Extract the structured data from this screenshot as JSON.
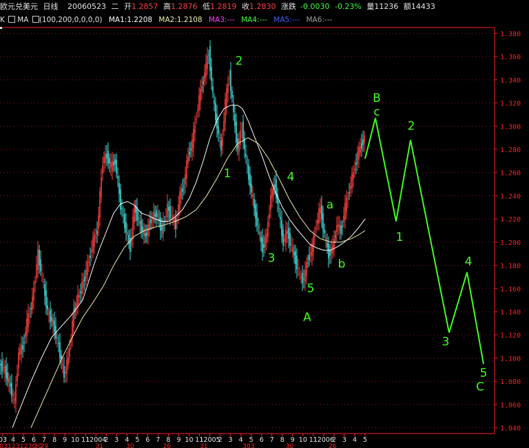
{
  "header": {
    "symbol": "欧元兑美元",
    "period": "日线",
    "date": "20060523",
    "weekday": "二",
    "open_label": "开",
    "open": "1.2857",
    "high_label": "高",
    "high": "1.2876",
    "low_label": "低",
    "low": "1.2819",
    "close_label": "收",
    "close": "1.2830",
    "change_label": "涨跌",
    "change": "-0.0030",
    "change_pct": "-0.23%",
    "volume_label": "量",
    "volume": "11236",
    "amount_label": "额",
    "amount": "14433"
  },
  "indicator": {
    "k_label": "K",
    "ma_label": "MA",
    "params": "(100,200,0,0,0,0)",
    "ma1": "MA1:1.2208",
    "ma2": "MA2:1.2108",
    "ma3": "MA3:---",
    "ma4": "MA4:---",
    "ma5": "MA5:---",
    "ma6": "MA6:---"
  },
  "colors": {
    "up": "#ff4040",
    "down": "#40e0e0",
    "ma1": "#ffffff",
    "ma2": "#f0f0b0",
    "ma3": "#ff40ff",
    "ma4": "#40ff40",
    "ma5": "#4060ff",
    "ma6": "#a0a0a0",
    "wave": "#40ff20",
    "axis": "#ff2020",
    "grid": "#a01818",
    "text": "#e6e6e6"
  },
  "chart_data": {
    "type": "line",
    "ylim": [
      1.035,
      1.385
    ],
    "yticks": [
      "1.380",
      "1.360",
      "1.340",
      "1.320",
      "1.300",
      "1.280",
      "1.260",
      "1.240",
      "1.220",
      "1.200",
      "1.180",
      "1.160",
      "1.140",
      "1.120",
      "1.100",
      "1.080",
      "1.060",
      "1.040"
    ],
    "month_ticks": [
      "03",
      "4",
      "5",
      "6",
      "7",
      "8",
      "9",
      "10",
      "11",
      "12004",
      "2",
      "3",
      "4",
      "5",
      "6",
      "7",
      "8",
      "9",
      "10",
      "11",
      "12005",
      "2",
      "3",
      "4",
      "5",
      "6",
      "7",
      "8",
      "9",
      "10",
      "11",
      "12006",
      "2",
      "3",
      "4",
      "5"
    ],
    "day_ticks": [
      "0",
      "31",
      "2",
      "31",
      "2",
      "30",
      "30",
      "29",
      "",
      "",
      "",
      "",
      "",
      "",
      "",
      "",
      "31",
      "",
      "",
      "",
      "",
      "30",
      "",
      "",
      "",
      "",
      "",
      "26",
      "",
      "",
      "",
      "",
      "",
      "31",
      "",
      "",
      "",
      "",
      "",
      "",
      "30",
      "3",
      "",
      "",
      "",
      "",
      "",
      "30",
      "",
      "",
      "",
      "",
      "",
      "",
      "26",
      "",
      "",
      "",
      "",
      "",
      "",
      "30",
      "3"
    ],
    "price_series": {
      "name": "EURUSD",
      "x": [
        0,
        8,
        16,
        22,
        28,
        34,
        40,
        48,
        56,
        62,
        70,
        78,
        86,
        94,
        100,
        108,
        116,
        124,
        130,
        136,
        142,
        150,
        156,
        162,
        168,
        176,
        184,
        190,
        196,
        204,
        212,
        220,
        228,
        236,
        244,
        250,
        256,
        262,
        268,
        274,
        280,
        286,
        292,
        298,
        304,
        310,
        316,
        322,
        328,
        334,
        340,
        346,
        352,
        358,
        364,
        370,
        376,
        382,
        388,
        394,
        400,
        406,
        412,
        418,
        424,
        430,
        436,
        442,
        448,
        454,
        460,
        466,
        472,
        478,
        484,
        490,
        496,
        502,
        508,
        514,
        520,
        526,
        530
      ],
      "y": [
        1.095,
        1.09,
        1.075,
        1.062,
        1.105,
        1.11,
        1.13,
        1.15,
        1.19,
        1.17,
        1.14,
        1.13,
        1.11,
        1.085,
        1.1,
        1.14,
        1.155,
        1.17,
        1.185,
        1.2,
        1.21,
        1.27,
        1.275,
        1.265,
        1.27,
        1.232,
        1.21,
        1.195,
        1.23,
        1.215,
        1.205,
        1.22,
        1.225,
        1.21,
        1.23,
        1.222,
        1.215,
        1.24,
        1.25,
        1.275,
        1.285,
        1.31,
        1.33,
        1.345,
        1.365,
        1.325,
        1.3,
        1.28,
        1.32,
        1.345,
        1.31,
        1.28,
        1.3,
        1.27,
        1.25,
        1.23,
        1.21,
        1.195,
        1.205,
        1.24,
        1.25,
        1.225,
        1.2,
        1.21,
        1.195,
        1.185,
        1.17,
        1.168,
        1.185,
        1.195,
        1.215,
        1.23,
        1.205,
        1.19,
        1.195,
        1.215,
        1.21,
        1.23,
        1.245,
        1.26,
        1.275,
        1.285,
        1.29
      ]
    },
    "ma1_series": {
      "name": "MA1",
      "x": [
        18,
        30,
        45,
        60,
        75,
        90,
        105,
        120,
        135,
        145,
        155,
        165,
        175,
        185,
        195,
        205,
        215,
        225,
        235,
        245,
        255,
        265,
        275,
        285,
        295,
        305,
        315,
        325,
        335,
        345,
        352,
        360,
        370,
        380,
        390,
        400,
        410,
        420,
        430,
        440,
        450,
        460,
        470,
        480,
        490,
        500,
        510,
        520,
        530
      ],
      "y": [
        1.04,
        1.058,
        1.08,
        1.1,
        1.118,
        1.128,
        1.138,
        1.15,
        1.178,
        1.195,
        1.21,
        1.225,
        1.233,
        1.235,
        1.232,
        1.225,
        1.223,
        1.22,
        1.218,
        1.218,
        1.222,
        1.228,
        1.238,
        1.252,
        1.27,
        1.29,
        1.305,
        1.315,
        1.318,
        1.318,
        1.315,
        1.305,
        1.29,
        1.275,
        1.258,
        1.243,
        1.23,
        1.22,
        1.212,
        1.205,
        1.198,
        1.195,
        1.193,
        1.193,
        1.196,
        1.2,
        1.205,
        1.212,
        1.22
      ]
    },
    "ma2_series": {
      "name": "MA2",
      "x": [
        45,
        60,
        75,
        90,
        105,
        120,
        135,
        150,
        165,
        180,
        195,
        210,
        225,
        240,
        255,
        270,
        285,
        300,
        315,
        330,
        345,
        360,
        375,
        390,
        405,
        420,
        435,
        450,
        465,
        480,
        495,
        510,
        520,
        530
      ],
      "y": [
        1.04,
        1.06,
        1.08,
        1.1,
        1.118,
        1.135,
        1.148,
        1.162,
        1.18,
        1.195,
        1.205,
        1.21,
        1.213,
        1.215,
        1.218,
        1.222,
        1.228,
        1.24,
        1.255,
        1.272,
        1.285,
        1.29,
        1.285,
        1.272,
        1.255,
        1.237,
        1.222,
        1.21,
        1.203,
        1.2,
        1.2,
        1.203,
        1.206,
        1.21
      ]
    },
    "wave_projection": {
      "x": [
        530,
        545,
        575,
        596,
        652,
        678,
        702
      ],
      "y": [
        1.272,
        1.307,
        1.218,
        1.288,
        1.122,
        1.174,
        1.095
      ]
    },
    "annotations": [
      {
        "text": "2",
        "x": 347,
        "y": 1.353
      },
      {
        "text": "1",
        "x": 330,
        "y": 1.256
      },
      {
        "text": "4",
        "x": 422,
        "y": 1.253
      },
      {
        "text": "3",
        "x": 394,
        "y": 1.183
      },
      {
        "text": "a",
        "x": 479,
        "y": 1.229
      },
      {
        "text": "b",
        "x": 496,
        "y": 1.178
      },
      {
        "text": "5",
        "x": 451,
        "y": 1.157
      },
      {
        "text": "A",
        "x": 446,
        "y": 1.132
      },
      {
        "text": "B",
        "x": 547,
        "y": 1.321
      },
      {
        "text": "c",
        "x": 547,
        "y": 1.309
      },
      {
        "text": "2",
        "x": 597,
        "y": 1.297
      },
      {
        "text": "1",
        "x": 580,
        "y": 1.201
      },
      {
        "text": "4",
        "x": 680,
        "y": 1.18
      },
      {
        "text": "3",
        "x": 647,
        "y": 1.111
      },
      {
        "text": "5",
        "x": 702,
        "y": 1.084
      },
      {
        "text": "C",
        "x": 697,
        "y": 1.072
      }
    ]
  }
}
